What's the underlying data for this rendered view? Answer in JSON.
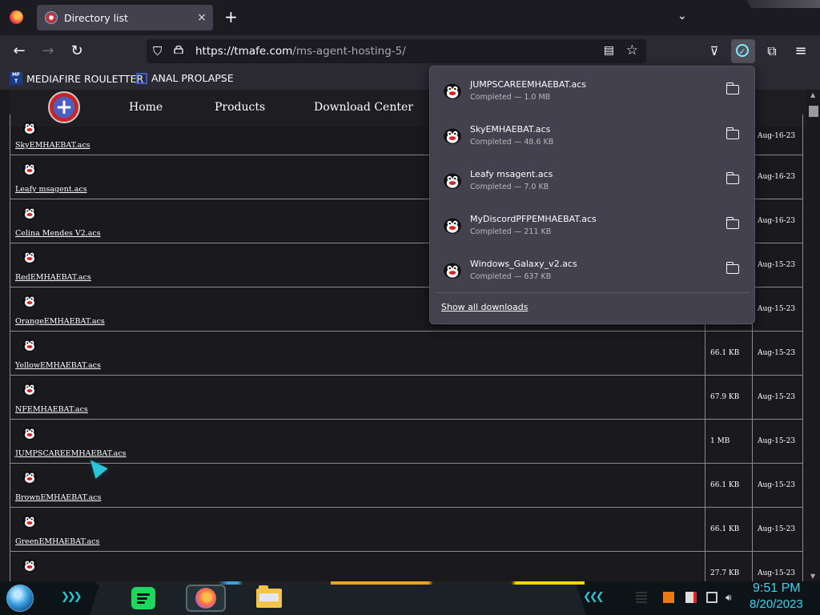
{
  "tab": {
    "title": "Directory list",
    "close": "×"
  },
  "newtab": "+",
  "tablist_chevron": "⌄",
  "url": {
    "host": "https://tmafe.com",
    "path": "/ms-agent-hosting-5/"
  },
  "bookmarks": [
    {
      "label": "MEDIAFIRE ROULETTER",
      "icon_text": "MF T"
    },
    {
      "label": "ANAL PROLAPSE"
    }
  ],
  "site_nav": [
    "Home",
    "Products",
    "Download Center"
  ],
  "files": [
    {
      "name": "SkyEMHAEBAT.acs",
      "size": "",
      "date": "Aug-16-23"
    },
    {
      "name": "Leafy msagent.acs",
      "size": "",
      "date": "Aug-16-23"
    },
    {
      "name": "Celina Mendes V2.acs",
      "size": "",
      "date": "Aug-16-23"
    },
    {
      "name": "RedEMHAEBAT.acs",
      "size": "",
      "date": "Aug-15-23"
    },
    {
      "name": "OrangeEMHAEBAT.acs",
      "size": "",
      "date": "Aug-15-23"
    },
    {
      "name": "YellowEMHAEBAT.acs",
      "size": "66.1 KB",
      "date": "Aug-15-23"
    },
    {
      "name": "NFEMHAEBAT.acs",
      "size": "67.9 KB",
      "date": "Aug-15-23"
    },
    {
      "name": "JUMPSCAREEMHAEBAT.acs",
      "size": "1 MB",
      "date": "Aug-15-23"
    },
    {
      "name": "BrownEMHAEBAT.acs",
      "size": "66.1 KB",
      "date": "Aug-15-23"
    },
    {
      "name": "GreenEMHAEBAT.acs",
      "size": "66.1 KB",
      "date": "Aug-15-23"
    },
    {
      "name": "",
      "size": "27.7 KB",
      "date": "Aug-15-23"
    }
  ],
  "downloads": [
    {
      "name": "JUMPSCAREEMHAEBAT.acs",
      "status": "Completed — 1.0 MB"
    },
    {
      "name": "SkyEMHAEBAT.acs",
      "status": "Completed — 48.6 KB"
    },
    {
      "name": "Leafy msagent.acs",
      "status": "Completed — 7.0 KB"
    },
    {
      "name": "MyDiscordPFPEMHAEBAT.acs",
      "status": "Completed — 211 KB"
    },
    {
      "name": "Windows_Galaxy_v2.acs",
      "status": "Completed — 637 KB"
    }
  ],
  "show_all_downloads": "Show all downloads",
  "clock": {
    "time": "9:51 PM",
    "date": "8/20/2023"
  },
  "colors": {
    "accent": "#80ebff",
    "taskbar_clock": "#36d6f0",
    "spotify": "#1ed760"
  }
}
